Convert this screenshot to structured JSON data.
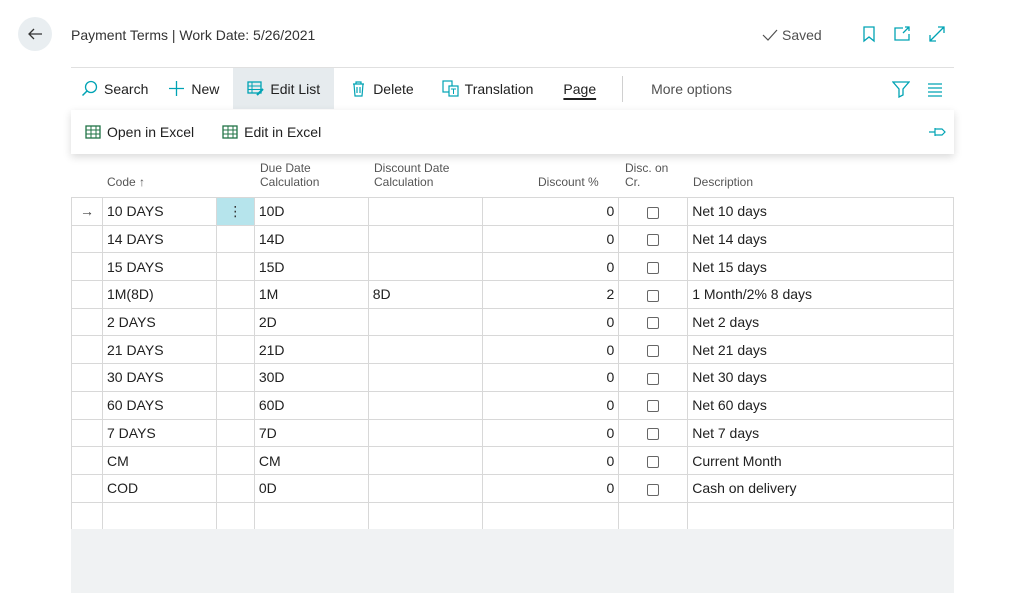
{
  "header": {
    "title": "Payment Terms | Work Date: 5/26/2021",
    "saved_label": "Saved"
  },
  "actions": {
    "search": "Search",
    "new": "New",
    "edit_list": "Edit List",
    "delete": "Delete",
    "translation": "Translation",
    "page": "Page",
    "more_options": "More options"
  },
  "excel": {
    "open": "Open in Excel",
    "edit": "Edit in Excel"
  },
  "columns": {
    "code": "Code",
    "code_sort": "↑",
    "due_date_1": "Due Date",
    "due_date_2": "Calculation",
    "disc_date_1": "Discount Date",
    "disc_date_2": "Calculation",
    "discount_pct": "Discount %",
    "disc_cr_1": "Disc. on",
    "disc_cr_2": "Cr.",
    "description": "Description"
  },
  "rows": [
    {
      "code": "10 DAYS",
      "due": "10D",
      "disc_date": "",
      "disc_pct": "0",
      "desc": "Net 10 days"
    },
    {
      "code": "14 DAYS",
      "due": "14D",
      "disc_date": "",
      "disc_pct": "0",
      "desc": "Net 14 days"
    },
    {
      "code": "15 DAYS",
      "due": "15D",
      "disc_date": "",
      "disc_pct": "0",
      "desc": "Net 15 days"
    },
    {
      "code": "1M(8D)",
      "due": "1M",
      "disc_date": "8D",
      "disc_pct": "2",
      "desc": "1 Month/2% 8 days"
    },
    {
      "code": "2 DAYS",
      "due": "2D",
      "disc_date": "",
      "disc_pct": "0",
      "desc": "Net 2 days"
    },
    {
      "code": "21 DAYS",
      "due": "21D",
      "disc_date": "",
      "disc_pct": "0",
      "desc": "Net 21 days"
    },
    {
      "code": "30 DAYS",
      "due": "30D",
      "disc_date": "",
      "disc_pct": "0",
      "desc": "Net 30 days"
    },
    {
      "code": "60 DAYS",
      "due": "60D",
      "disc_date": "",
      "disc_pct": "0",
      "desc": "Net 60 days"
    },
    {
      "code": "7 DAYS",
      "due": "7D",
      "disc_date": "",
      "disc_pct": "0",
      "desc": "Net 7 days"
    },
    {
      "code": "CM",
      "due": "CM",
      "disc_date": "",
      "disc_pct": "0",
      "desc": "Current Month"
    },
    {
      "code": "COD",
      "due": "0D",
      "disc_date": "",
      "disc_pct": "0",
      "desc": "Cash on delivery"
    }
  ],
  "colors": {
    "accent": "#00a3b4",
    "active_action_bg": "#e6ebee",
    "selected_cell": "#b6e4ec",
    "excel_green": "#217346"
  }
}
